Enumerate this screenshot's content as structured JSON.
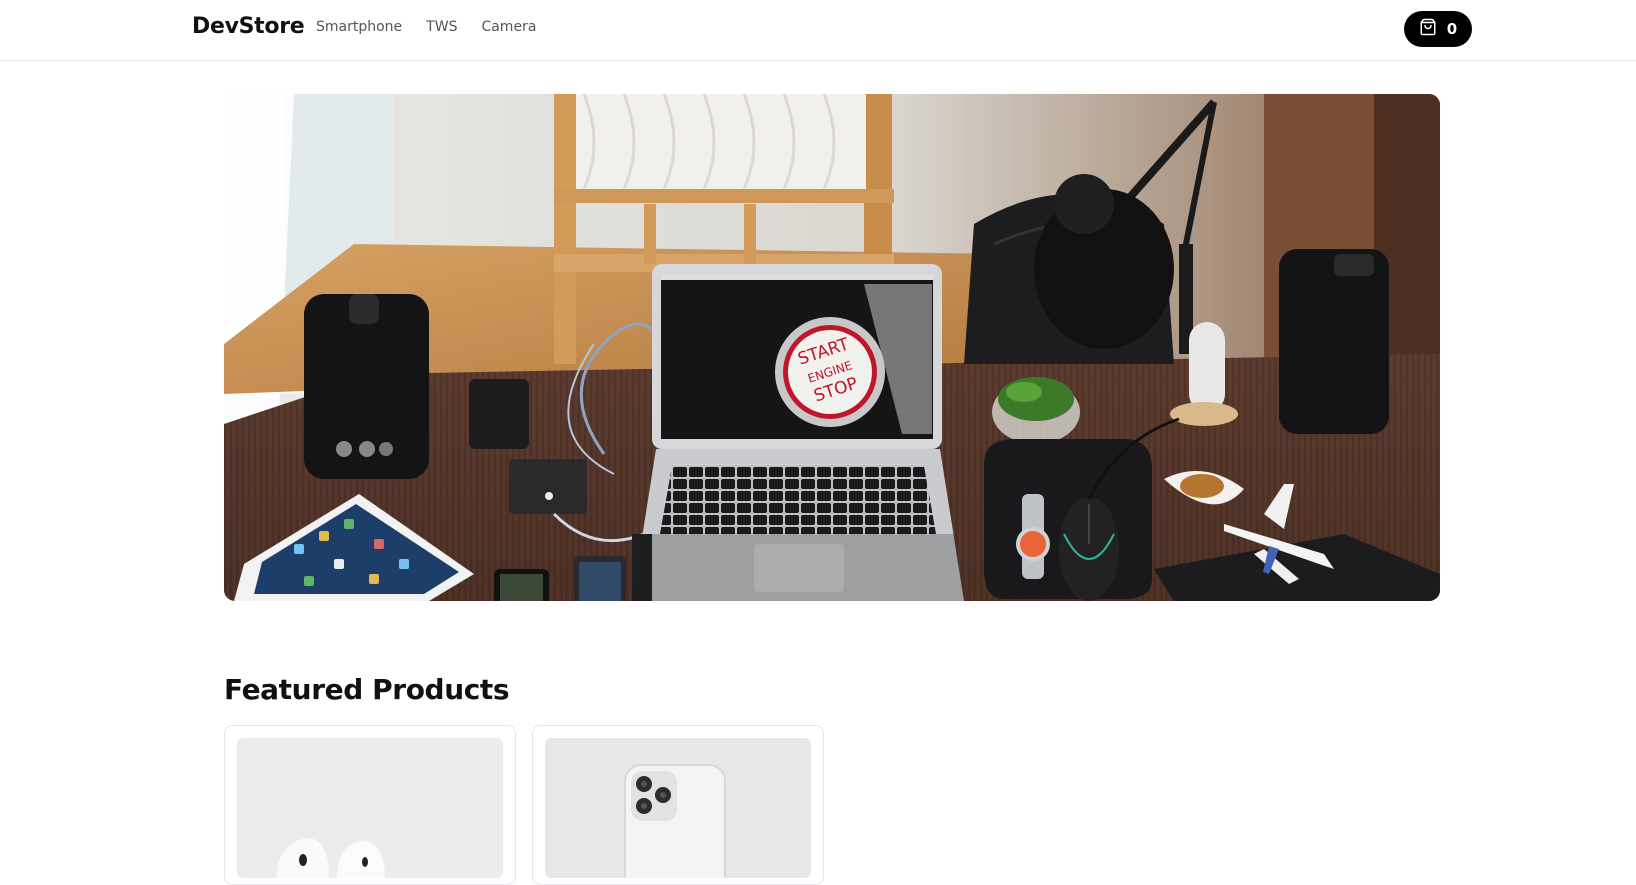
{
  "navbar": {
    "brand": "DevStore",
    "links": [
      {
        "label": "Smartphone"
      },
      {
        "label": "TWS"
      },
      {
        "label": "Camera"
      }
    ],
    "cart": {
      "count": "0",
      "icon": "shopping-bag-icon"
    }
  },
  "hero": {
    "image": "desk-setup-with-laptop-speakers-and-lamp",
    "laptop_screen_text": [
      "START",
      "ENGINE",
      "STOP"
    ]
  },
  "featured": {
    "title": "Featured Products",
    "products": [
      {
        "image": "wireless-earbuds"
      },
      {
        "image": "silver-smartphone-rear-cameras"
      }
    ]
  },
  "colors": {
    "accent": "#000000",
    "border": "#e5e7eb",
    "text_primary": "#111111",
    "text_secondary": "#555555"
  }
}
